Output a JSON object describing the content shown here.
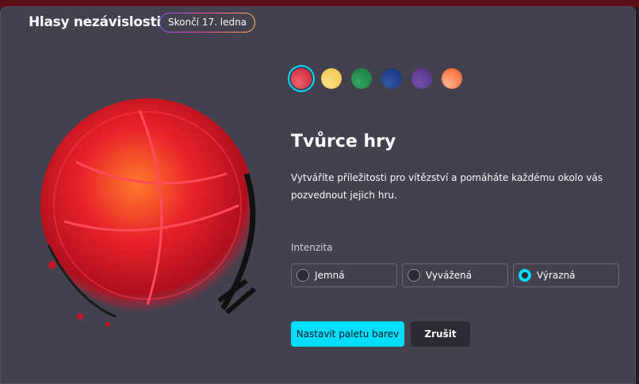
{
  "header": {
    "title": "Hlasy nezávislosti",
    "badge": "Skončí 17. ledna"
  },
  "swatches": [
    {
      "name": "red",
      "color": "#d43a4c",
      "selected": true
    },
    {
      "name": "yellow",
      "color": "#f5cf5a",
      "selected": false
    },
    {
      "name": "green",
      "color": "#1f8a44",
      "selected": false
    },
    {
      "name": "blue",
      "color": "#1f3f8f",
      "selected": false
    },
    {
      "name": "purple",
      "color": "#5d3d96",
      "selected": false
    },
    {
      "name": "orange",
      "color": "#ff6a3a",
      "selected": false
    }
  ],
  "main": {
    "heading": "Tvůrce hry",
    "description": "Vytváříte příležitosti pro vítězství a pomáháte každému okolo vás pozvednout jejich hru."
  },
  "intensity": {
    "label": "Intenzita",
    "options": [
      {
        "label": "Jemná",
        "selected": false
      },
      {
        "label": "Vyvážená",
        "selected": false
      },
      {
        "label": "Výrazná",
        "selected": true
      }
    ]
  },
  "actions": {
    "primary": "Nastavit paletu barev",
    "cancel": "Zrušit"
  }
}
